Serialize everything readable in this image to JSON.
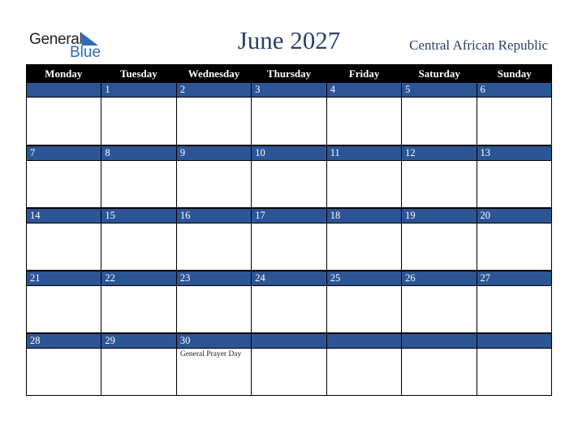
{
  "logo": {
    "line1": "General",
    "line2": "Blue"
  },
  "header": {
    "title": "June 2027",
    "country": "Central African Republic"
  },
  "colors": {
    "date_bar": "#2c5596",
    "header_bg": "#000000",
    "title": "#2b4168",
    "logo_blue": "#2a6cb5"
  },
  "weekdays": [
    "Monday",
    "Tuesday",
    "Wednesday",
    "Thursday",
    "Friday",
    "Saturday",
    "Sunday"
  ],
  "weeks": [
    [
      {
        "d": ""
      },
      {
        "d": "1"
      },
      {
        "d": "2"
      },
      {
        "d": "3"
      },
      {
        "d": "4"
      },
      {
        "d": "5"
      },
      {
        "d": "6"
      }
    ],
    [
      {
        "d": "7"
      },
      {
        "d": "8"
      },
      {
        "d": "9"
      },
      {
        "d": "10"
      },
      {
        "d": "11"
      },
      {
        "d": "12"
      },
      {
        "d": "13"
      }
    ],
    [
      {
        "d": "14"
      },
      {
        "d": "15"
      },
      {
        "d": "16"
      },
      {
        "d": "17"
      },
      {
        "d": "18"
      },
      {
        "d": "19"
      },
      {
        "d": "20"
      }
    ],
    [
      {
        "d": "21"
      },
      {
        "d": "22"
      },
      {
        "d": "23"
      },
      {
        "d": "24"
      },
      {
        "d": "25"
      },
      {
        "d": "26"
      },
      {
        "d": "27"
      }
    ],
    [
      {
        "d": "28"
      },
      {
        "d": "29"
      },
      {
        "d": "30",
        "event": "General Prayer Day"
      },
      {
        "d": ""
      },
      {
        "d": ""
      },
      {
        "d": ""
      },
      {
        "d": ""
      }
    ]
  ]
}
